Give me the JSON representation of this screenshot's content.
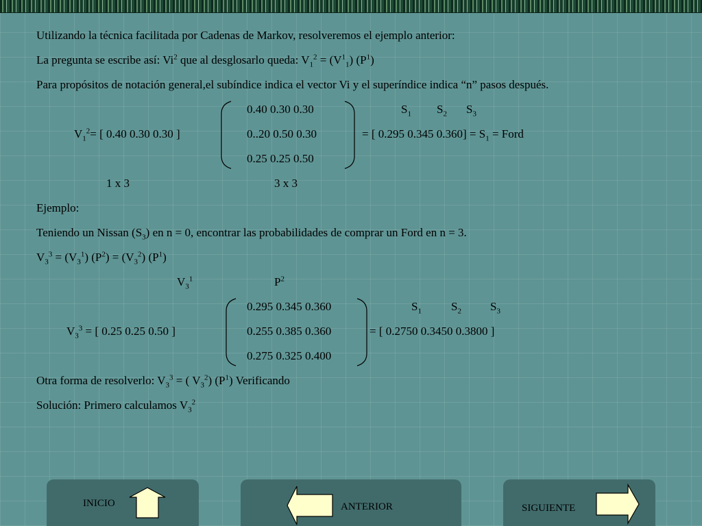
{
  "lines": {
    "l1": "Utilizando la técnica facilitada por Cadenas de Markov, resolveremos el ejemplo anterior:",
    "l2_a": "La pregunta se escribe así: Vi",
    "l2_sup_1": "2",
    "l2_b": " que al desglosarlo queda: V",
    "l2_sub_1": "1",
    "l2_sup_2": "2",
    "l2_c": " = (V",
    "l2_sup_3": "1",
    "l2_sub_2": "1",
    "l2_d": ") (P",
    "l2_sup_4": "1",
    "l2_e": ")",
    "l3": "Para propósitos de notación general,el subíndice indica el vector Vi y el superíndice indica “n” pasos después."
  },
  "eq1": {
    "matrix_rows": [
      "0.40  0.30  0.30",
      "0..20 0.50  0.30",
      "0.25  0.25  0.50"
    ],
    "s_labels": [
      {
        "main": "S",
        "sub": "1"
      },
      {
        "main": "S",
        "sub": "2"
      },
      {
        "main": "S",
        "sub": "3"
      }
    ],
    "lhs_main": "V",
    "lhs_sub": "1",
    "lhs_sup": "2",
    "lhs_rest": "= [ 0.40 0.30 0.30 ]",
    "rhs_a": "= [ 0.295 0.345 0.360] = S",
    "rhs_sub": "1",
    "rhs_b": " = Ford",
    "dim_left": "1 x 3",
    "dim_right": "3 x 3"
  },
  "example": {
    "label": "Ejemplo:",
    "text_a": "Teniendo un Nissan (S",
    "text_sub": "3",
    "text_b": ") en n = 0, encontrar las probabilidades de comprar un Ford en n = 3.",
    "formula": {
      "p1": "V",
      "sub1": "3",
      "sup1": "3",
      "p2": " = (V",
      "sub2": "3",
      "sup2": "1",
      "p3": ") (P",
      "sup3": "2",
      "p4": ") = (V",
      "sub4": "3",
      "sup4": "2",
      "p5": ") (P",
      "sup5": "1",
      "p6": ")"
    },
    "header_v": {
      "main": "V",
      "sub": "3",
      "sup": "1"
    },
    "header_p": {
      "main": "P",
      "sup": "2"
    }
  },
  "eq2": {
    "matrix_rows": [
      "0.295  0.345  0.360",
      "0.255  0.385  0.360",
      "0.275  0.325  0.400"
    ],
    "s_labels": [
      {
        "main": "S",
        "sub": "1"
      },
      {
        "main": "S",
        "sub": "2"
      },
      {
        "main": "S",
        "sub": "3"
      }
    ],
    "lhs_main": "V",
    "lhs_sub": "3",
    "lhs_sup": "3",
    "lhs_rest": " = [ 0.25 0.25 0.50  ]",
    "rhs": "= [ 0.2750  0.3450  0.3800 ]"
  },
  "other": {
    "a": "Otra forma de resolverlo: V",
    "sub1": "3",
    "sup1": "3",
    "b": " = ( V",
    "sub2": "3",
    "sup2": "2",
    "c": ") (P",
    "sup3": "1",
    "d": ")    Verificando"
  },
  "solution": {
    "a": "Solución: Primero calculamos V",
    "sub": "3",
    "sup": "2"
  },
  "nav": {
    "inicio": "INICIO",
    "anterior": "ANTERIOR",
    "siguiente": "SIGUIENTE"
  },
  "colors": {
    "background": "#5f9494",
    "nav_panel": "#416b6b",
    "arrow_fill": "#ffffcc"
  }
}
